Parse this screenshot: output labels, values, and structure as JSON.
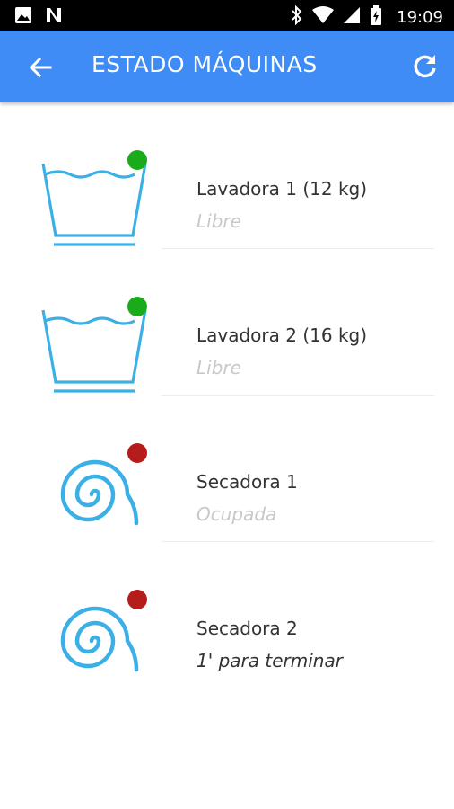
{
  "status_bar": {
    "time": "19:09",
    "icons": [
      "image-icon",
      "n-notification-icon",
      "bluetooth-icon",
      "wifi-icon",
      "signal-icon",
      "battery-icon"
    ]
  },
  "app_bar": {
    "title": "ESTADO MÁQUINAS",
    "color": "#3f8cf6"
  },
  "machines": [
    {
      "name": "Lavadora 1 (12 kg)",
      "status": "Libre",
      "type": "washer",
      "indicator_color": "#1aab1a"
    },
    {
      "name": "Lavadora 2 (16 kg)",
      "status": "Libre",
      "type": "washer",
      "indicator_color": "#1aab1a"
    },
    {
      "name": "Secadora 1",
      "status": "Ocupada",
      "type": "dryer",
      "indicator_color": "#b71c1c"
    },
    {
      "name": "Secadora 2",
      "status": "1' para terminar",
      "type": "dryer",
      "indicator_color": "#b71c1c"
    }
  ],
  "icon_color": "#3bb0e6"
}
